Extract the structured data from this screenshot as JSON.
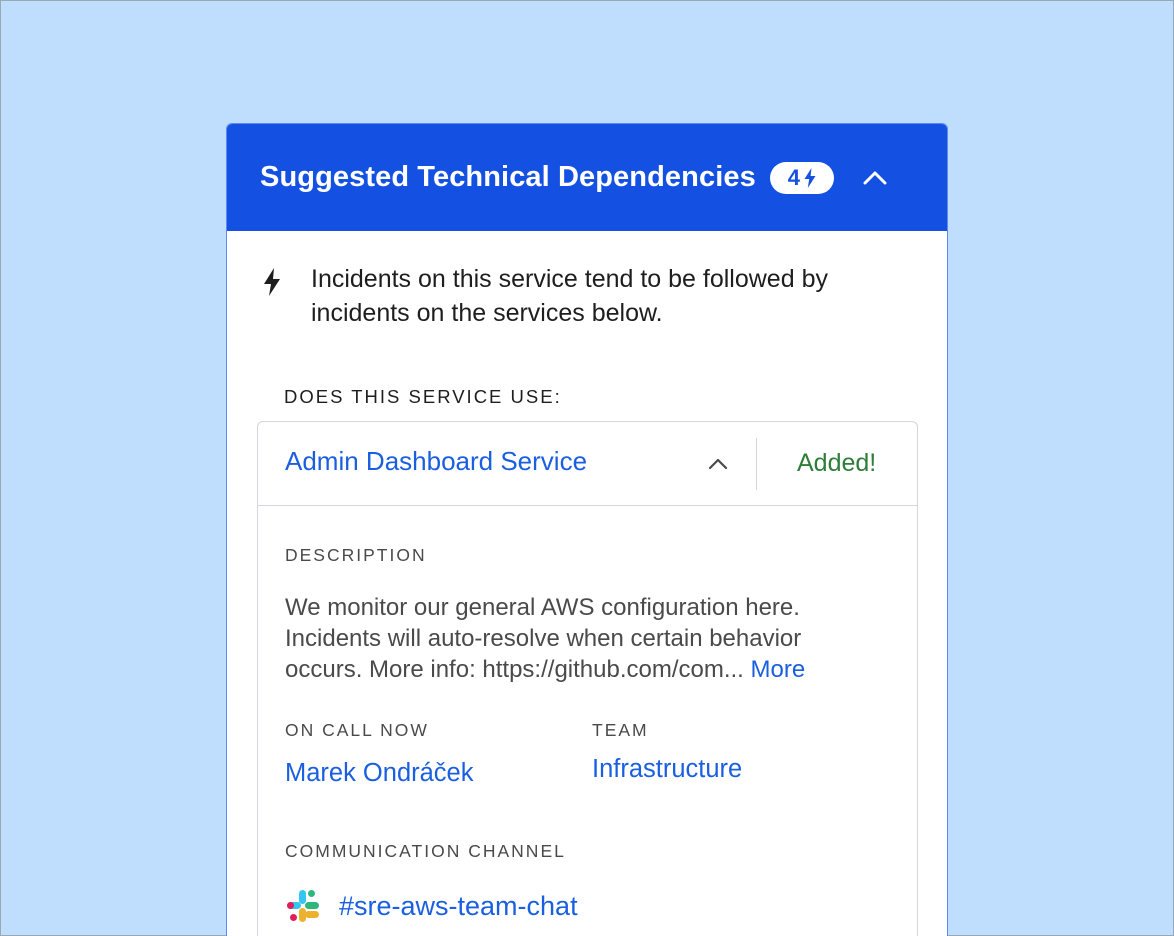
{
  "panel": {
    "title": "Suggested Technical Dependencies",
    "badge_count": "4",
    "badge_icon": "lightning-bolt-icon",
    "collapse_icon": "chevron-up-icon",
    "hint_icon": "lightning-bolt-icon",
    "hint_text": "Incidents on this service tend to be followed by incidents on the services below.",
    "section_label": "DOES THIS SERVICE USE:"
  },
  "service": {
    "name": "Admin Dashboard Service",
    "status": "Added!",
    "description_label": "DESCRIPTION",
    "description": "We monitor our general AWS configuration here. Incidents will auto-resolve when certain behavior occurs. More info: https://github.com/com...",
    "more_label": "More",
    "on_call_label": "ON CALL NOW",
    "on_call_name": "Marek Ondráček",
    "team_label": "TEAM",
    "team_name": "Infrastructure",
    "channel_label": "COMMUNICATION CHANNEL",
    "channel_icon": "slack-icon",
    "channel_name": "#sre-aws-team-chat"
  },
  "colors": {
    "background": "#bfdefe",
    "header": "#1451e3",
    "link": "#1a5fdf",
    "success": "#2e7d3a"
  }
}
